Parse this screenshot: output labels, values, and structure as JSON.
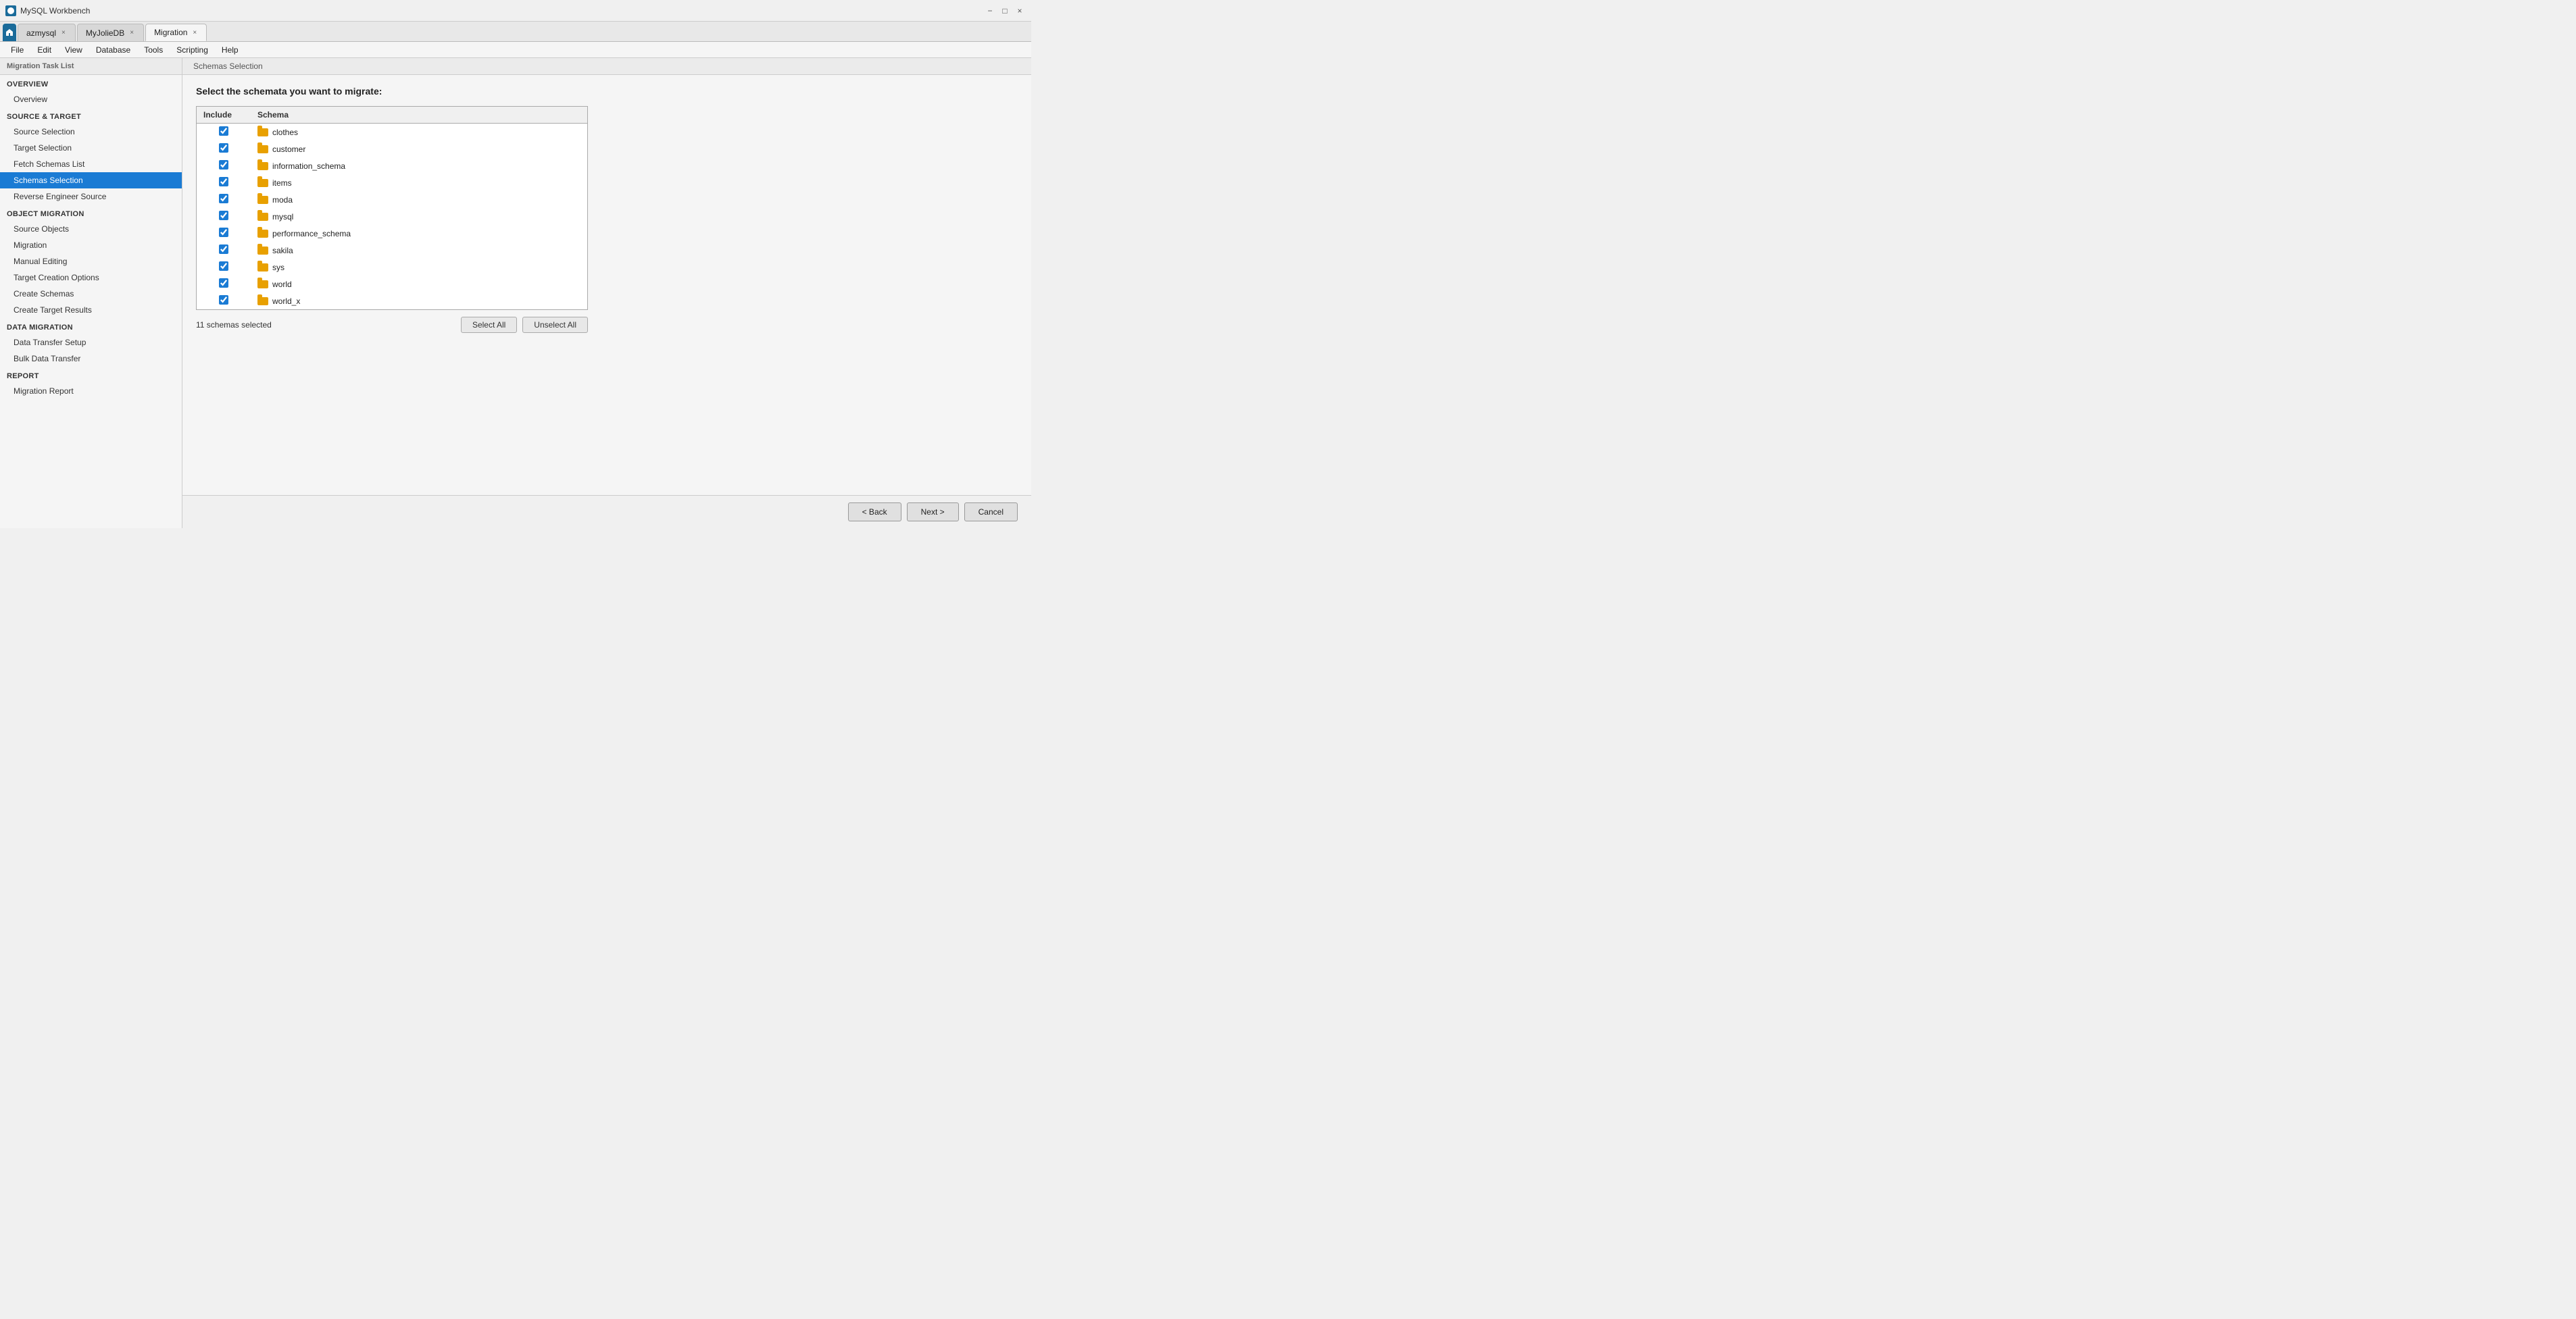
{
  "app": {
    "title": "MySQL Workbench",
    "icon": "mysql"
  },
  "tabs": [
    {
      "id": "azmysql",
      "label": "azmysql",
      "closable": true,
      "active": false
    },
    {
      "id": "myjolie",
      "label": "MyJolieDB",
      "closable": true,
      "active": false
    },
    {
      "id": "migration",
      "label": "Migration",
      "closable": true,
      "active": true
    }
  ],
  "menu": {
    "items": [
      "File",
      "Edit",
      "View",
      "Database",
      "Tools",
      "Scripting",
      "Help"
    ]
  },
  "sidebar": {
    "header": "Migration Task List",
    "sections": [
      {
        "label": "OVERVIEW",
        "items": [
          {
            "id": "overview",
            "label": "Overview",
            "active": false
          }
        ]
      },
      {
        "label": "SOURCE & TARGET",
        "items": [
          {
            "id": "source-selection",
            "label": "Source Selection",
            "active": false
          },
          {
            "id": "target-selection",
            "label": "Target Selection",
            "active": false
          },
          {
            "id": "fetch-schemas",
            "label": "Fetch Schemas List",
            "active": false
          },
          {
            "id": "schemas-selection",
            "label": "Schemas Selection",
            "active": true
          },
          {
            "id": "reverse-engineer",
            "label": "Reverse Engineer Source",
            "active": false
          }
        ]
      },
      {
        "label": "OBJECT MIGRATION",
        "items": [
          {
            "id": "source-objects",
            "label": "Source Objects",
            "active": false
          },
          {
            "id": "migration",
            "label": "Migration",
            "active": false
          },
          {
            "id": "manual-editing",
            "label": "Manual Editing",
            "active": false
          },
          {
            "id": "target-creation",
            "label": "Target Creation Options",
            "active": false
          },
          {
            "id": "create-schemas",
            "label": "Create Schemas",
            "active": false
          },
          {
            "id": "create-target",
            "label": "Create Target Results",
            "active": false
          }
        ]
      },
      {
        "label": "DATA MIGRATION",
        "items": [
          {
            "id": "data-transfer",
            "label": "Data Transfer Setup",
            "active": false
          },
          {
            "id": "bulk-transfer",
            "label": "Bulk Data Transfer",
            "active": false
          }
        ]
      },
      {
        "label": "REPORT",
        "items": [
          {
            "id": "migration-report",
            "label": "Migration Report",
            "active": false
          }
        ]
      }
    ]
  },
  "content": {
    "header": "Schemas Selection",
    "title": "Select the schemata you want to migrate:",
    "table": {
      "columns": [
        "Include",
        "Schema"
      ],
      "rows": [
        {
          "checked": true,
          "schema": "clothes"
        },
        {
          "checked": true,
          "schema": "customer"
        },
        {
          "checked": true,
          "schema": "information_schema"
        },
        {
          "checked": true,
          "schema": "items"
        },
        {
          "checked": true,
          "schema": "moda"
        },
        {
          "checked": true,
          "schema": "mysql"
        },
        {
          "checked": true,
          "schema": "performance_schema"
        },
        {
          "checked": true,
          "schema": "sakila"
        },
        {
          "checked": true,
          "schema": "sys"
        },
        {
          "checked": true,
          "schema": "world"
        },
        {
          "checked": true,
          "schema": "world_x"
        }
      ]
    },
    "status": "11 schemas selected",
    "buttons": {
      "select_all": "Select All",
      "unselect_all": "Unselect All"
    }
  },
  "bottom_nav": {
    "back": "< Back",
    "next": "Next >",
    "cancel": "Cancel"
  },
  "titlebar": {
    "minimize": "−",
    "maximize": "□",
    "close": "×"
  }
}
